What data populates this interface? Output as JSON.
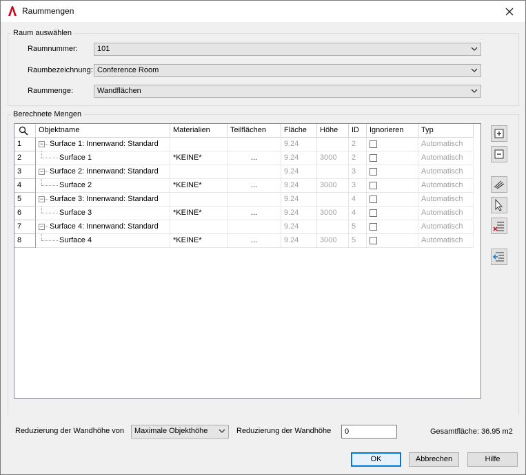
{
  "window": {
    "title": "Raummengen"
  },
  "room_select": {
    "group_label": "Raum auswählen",
    "raumnummer_label": "Raumnummer:",
    "raumnummer_value": "101",
    "raumbezeichnung_label": "Raumbezeichnung:",
    "raumbezeichnung_value": "Conference Room",
    "raummenge_label": "Raummenge:",
    "raummenge_value": "Wandflächen"
  },
  "quantities": {
    "group_label": "Berechnete Mengen",
    "columns": [
      "Objektname",
      "Materialien",
      "Teilflächen",
      "Fläche",
      "Höhe",
      "ID",
      "Ignorieren",
      "Typ"
    ],
    "rows": [
      {
        "num": "1",
        "name": "Surface 1: Innenwand: Standard",
        "material": "",
        "teil": "",
        "flaeche": "9.24",
        "hoehe": "",
        "id": "2",
        "typ": "Automatisch"
      },
      {
        "num": "2",
        "name": "Surface 1",
        "material": "*KEINE*",
        "teil": "...",
        "flaeche": "9.24",
        "hoehe": "3000",
        "id": "2",
        "typ": "Automatisch"
      },
      {
        "num": "3",
        "name": "Surface 2: Innenwand: Standard",
        "material": "",
        "teil": "",
        "flaeche": "9.24",
        "hoehe": "",
        "id": "3",
        "typ": "Automatisch"
      },
      {
        "num": "4",
        "name": "Surface 2",
        "material": "*KEINE*",
        "teil": "...",
        "flaeche": "9.24",
        "hoehe": "3000",
        "id": "3",
        "typ": "Automatisch"
      },
      {
        "num": "5",
        "name": "Surface 3: Innenwand: Standard",
        "material": "",
        "teil": "",
        "flaeche": "9.24",
        "hoehe": "",
        "id": "4",
        "typ": "Automatisch"
      },
      {
        "num": "6",
        "name": "Surface 3",
        "material": "*KEINE*",
        "teil": "...",
        "flaeche": "9.24",
        "hoehe": "3000",
        "id": "4",
        "typ": "Automatisch"
      },
      {
        "num": "7",
        "name": "Surface 4: Innenwand: Standard",
        "material": "",
        "teil": "",
        "flaeche": "9.24",
        "hoehe": "",
        "id": "5",
        "typ": "Automatisch"
      },
      {
        "num": "8",
        "name": "Surface 4",
        "material": "*KEINE*",
        "teil": "...",
        "flaeche": "9.24",
        "hoehe": "3000",
        "id": "5",
        "typ": "Automatisch"
      }
    ]
  },
  "footer": {
    "reduction_from_label": "Reduzierung der Wandhöhe von",
    "reduction_from_value": "Maximale Objekthöhe",
    "reduction_label": "Reduzierung der Wandhöhe",
    "reduction_value": "0",
    "total_area": "Gesamtfläche: 36.95 m2"
  },
  "buttons": {
    "ok": "OK",
    "cancel": "Abbrechen",
    "help": "Hilfe"
  },
  "colors": {
    "accent": "#0078d7",
    "app_icon": "#d0021b",
    "disabled_text": "#a0a0a0"
  }
}
